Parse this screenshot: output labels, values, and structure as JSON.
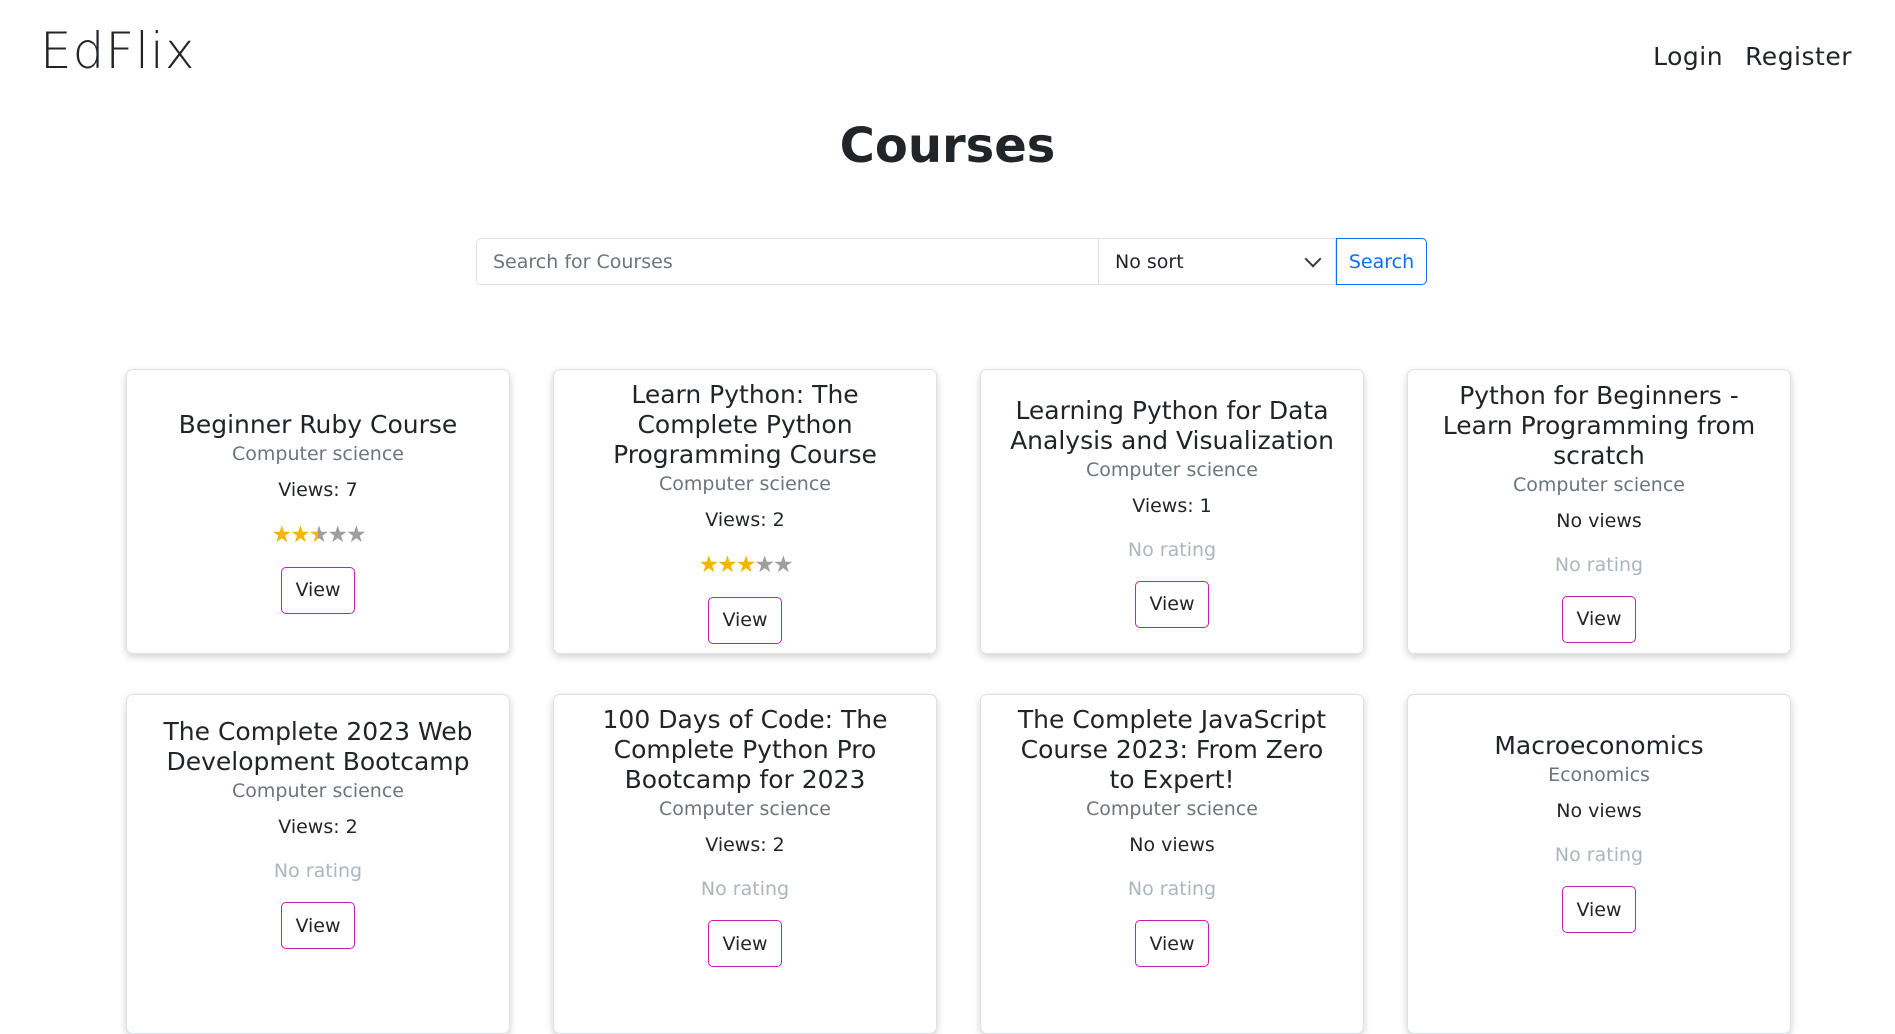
{
  "brand": "EdFlix",
  "nav": {
    "login": "Login",
    "register": "Register"
  },
  "page_title": "Courses",
  "search": {
    "placeholder": "Search for Courses",
    "value": "",
    "sort_selected": "No sort",
    "button": "Search"
  },
  "colors": {
    "primary": "#0d6efd",
    "view_button_border": "#c81cb0",
    "star_filled": "#f4b400",
    "star_empty": "#9e9e9e"
  },
  "courses": [
    {
      "title": "Beginner Ruby Course",
      "category": "Computer science",
      "views": "Views: 7",
      "rating_stars": 2.5,
      "rating_text": "",
      "button": "View"
    },
    {
      "title": "Learn Python: The Complete Python Programming Course",
      "category": "Computer science",
      "views": "Views: 2",
      "rating_stars": 3,
      "rating_text": "",
      "button": "View"
    },
    {
      "title": "Learning Python for Data Analysis and Visualization",
      "category": "Computer science",
      "views": "Views: 1",
      "rating_stars": null,
      "rating_text": "No rating",
      "button": "View"
    },
    {
      "title": "Python for Beginners - Learn Programming from scratch",
      "category": "Computer science",
      "views": "No views",
      "rating_stars": null,
      "rating_text": "No rating",
      "button": "View"
    },
    {
      "title": "The Complete 2023 Web Development Bootcamp",
      "category": "Computer science",
      "views": "Views: 2",
      "rating_stars": null,
      "rating_text": "No rating",
      "button": "View"
    },
    {
      "title": "100 Days of Code: The Complete Python Pro Bootcamp for 2023",
      "category": "Computer science",
      "views": "Views: 2",
      "rating_stars": null,
      "rating_text": "No rating",
      "button": "View"
    },
    {
      "title": "The Complete JavaScript Course 2023: From Zero to Expert!",
      "category": "Computer science",
      "views": "No views",
      "rating_stars": null,
      "rating_text": "No rating",
      "button": "View"
    },
    {
      "title": "Macroeconomics",
      "category": "Economics",
      "views": "No views",
      "rating_stars": null,
      "rating_text": "No rating",
      "button": "View"
    }
  ]
}
